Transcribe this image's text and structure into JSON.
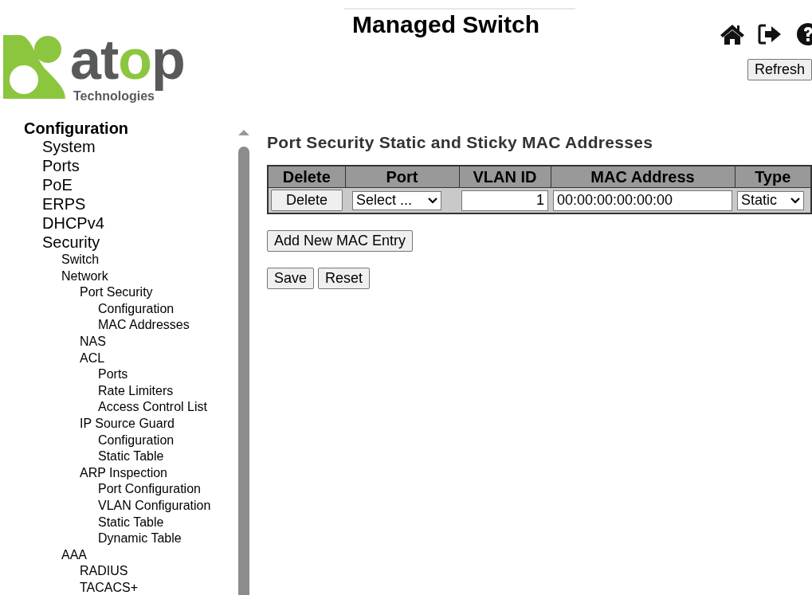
{
  "header": {
    "logo": {
      "wordmark": [
        {
          "text": "at",
          "color": "#58595b"
        },
        {
          "text": "o",
          "color": "#8cc63f"
        },
        {
          "text": "p",
          "color": "#58595b"
        }
      ],
      "tagline": "Technologies"
    },
    "title": "Managed Switch",
    "refresh_button": "Refresh"
  },
  "sidebar": {
    "items": [
      {
        "label": "Configuration",
        "children": [
          {
            "label": "System"
          },
          {
            "label": "Ports"
          },
          {
            "label": "PoE"
          },
          {
            "label": "ERPS"
          },
          {
            "label": "DHCPv4"
          },
          {
            "label": "Security",
            "children": [
              {
                "label": "Switch"
              },
              {
                "label": "Network",
                "children": [
                  {
                    "label": "Port Security",
                    "children": [
                      {
                        "label": "Configuration"
                      },
                      {
                        "label": "MAC Addresses"
                      }
                    ]
                  },
                  {
                    "label": "NAS"
                  },
                  {
                    "label": "ACL",
                    "children": [
                      {
                        "label": "Ports"
                      },
                      {
                        "label": "Rate Limiters"
                      },
                      {
                        "label": "Access Control List"
                      }
                    ]
                  },
                  {
                    "label": "IP Source Guard",
                    "children": [
                      {
                        "label": "Configuration"
                      },
                      {
                        "label": "Static Table"
                      }
                    ]
                  },
                  {
                    "label": "ARP Inspection",
                    "children": [
                      {
                        "label": "Port Configuration"
                      },
                      {
                        "label": "VLAN Configuration"
                      },
                      {
                        "label": "Static Table"
                      },
                      {
                        "label": "Dynamic Table"
                      }
                    ]
                  }
                ]
              },
              {
                "label": "AAA",
                "children": [
                  {
                    "label": "RADIUS"
                  },
                  {
                    "label": "TACACS+"
                  }
                ]
              }
            ]
          }
        ]
      }
    ]
  },
  "page": {
    "title": "Port Security Static and Sticky MAC Addresses",
    "table": {
      "columns": [
        "Delete",
        "Port",
        "VLAN ID",
        "MAC Address",
        "Type"
      ],
      "rows": [
        {
          "delete_button": "Delete",
          "port": "Select ...",
          "vlan_id": "1",
          "mac_address": "00:00:00:00:00:00",
          "type": "Static"
        }
      ]
    },
    "add_button": "Add New MAC Entry",
    "buttons": [
      "Save",
      "Reset"
    ]
  }
}
